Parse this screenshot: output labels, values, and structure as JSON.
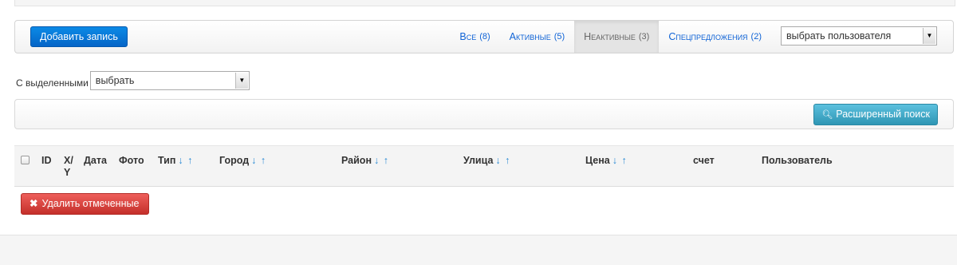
{
  "toolbar": {
    "add_label": "Добавить запись",
    "filters": [
      {
        "label": "Все",
        "count": "(8)",
        "active": false
      },
      {
        "label": "Активные",
        "count": "(5)",
        "active": false
      },
      {
        "label": "Неактивные",
        "count": "(3)",
        "active": true
      },
      {
        "label": "Спецпредложения",
        "count": "(2)",
        "active": false
      }
    ],
    "user_select": "выбрать пользователя"
  },
  "bulk": {
    "label": "С выделенными",
    "select": "выбрать"
  },
  "search": {
    "button_label": "Расширенный поиск"
  },
  "table": {
    "headers": {
      "id": "ID",
      "xy_top": "X/",
      "xy_bottom": "Y",
      "date": "Дата",
      "photo": "Фото",
      "type": "Тип",
      "city": "Город",
      "district": "Район",
      "street": "Улица",
      "price": "Цена",
      "account": "счет",
      "user": "Пользователь"
    },
    "sort_arrows": "↓↑"
  },
  "delete": {
    "label": "Удалить отмеченные"
  },
  "colors": {
    "primary": "#0565c7",
    "link": "#0f63d6",
    "info": "#2f96b4",
    "danger": "#c42f2a",
    "sort_arrow": "#2a8ad4"
  }
}
